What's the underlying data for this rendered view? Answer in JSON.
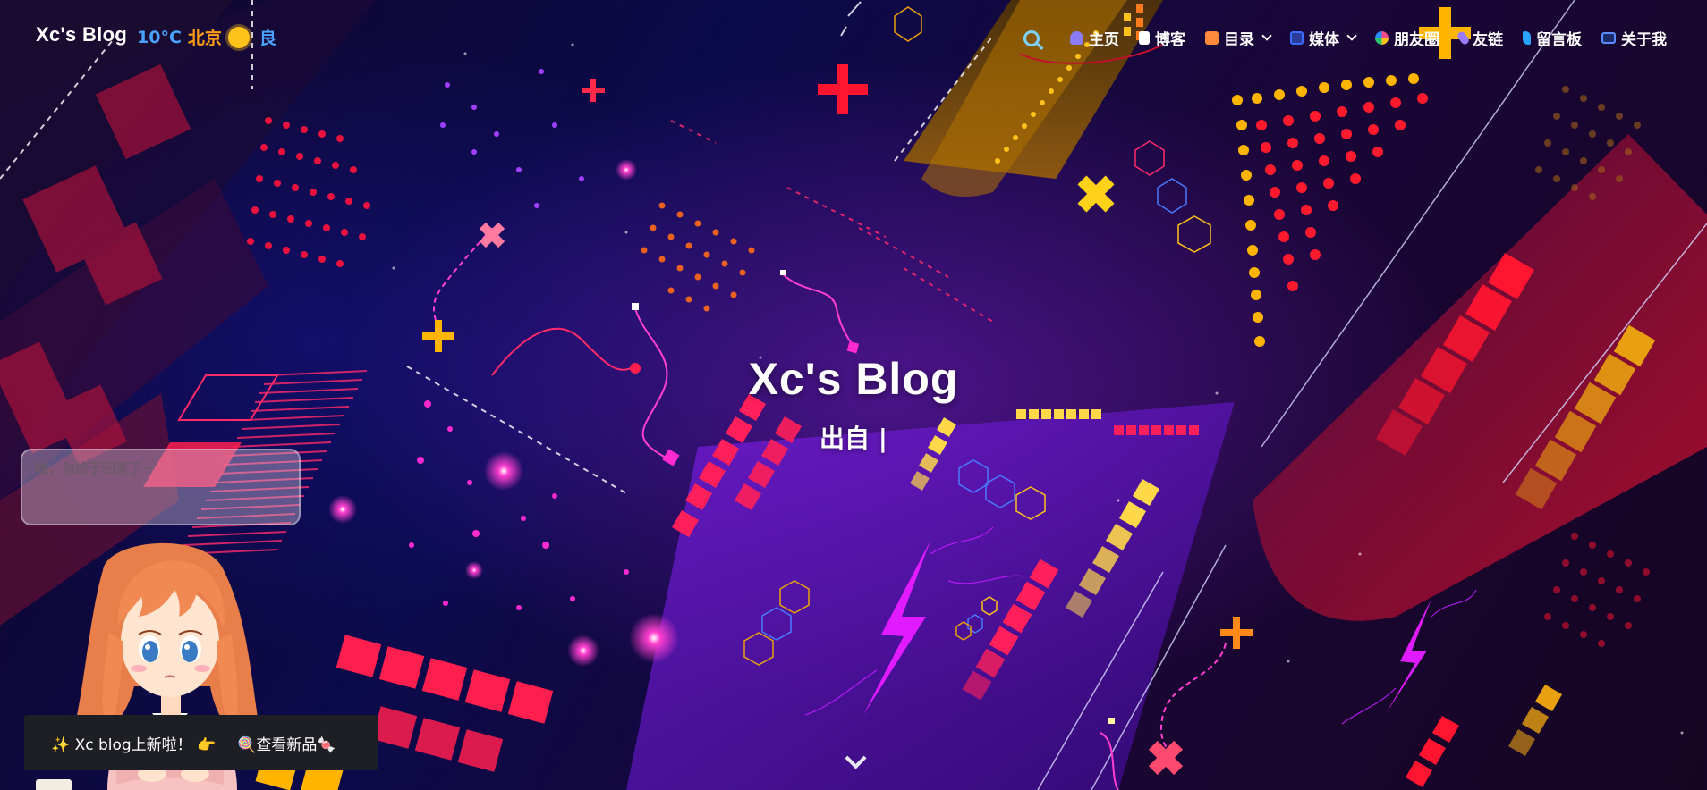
{
  "header": {
    "brand": "Xc's Blog",
    "weather": {
      "temperature": "10°C",
      "city": "北京",
      "icon": "sun-icon",
      "air_quality": "良"
    },
    "menu": [
      {
        "id": "home",
        "label": "主页",
        "icon": "home-icon",
        "dropdown": false,
        "color": "#8b7cf6"
      },
      {
        "id": "blog",
        "label": "博客",
        "icon": "document-icon",
        "dropdown": false,
        "color": "#ffffff"
      },
      {
        "id": "catalog",
        "label": "目录",
        "icon": "list-icon",
        "dropdown": true,
        "color": "#ff8a3c"
      },
      {
        "id": "media",
        "label": "媒体",
        "icon": "media-icon",
        "dropdown": true,
        "color": "#3c6cff"
      },
      {
        "id": "moments",
        "label": "朋友圈",
        "icon": "pinwheel-icon",
        "dropdown": false,
        "color": "#f04a8a"
      },
      {
        "id": "friends",
        "label": "友链",
        "icon": "link-icon",
        "dropdown": false,
        "color": "#9a7cff"
      },
      {
        "id": "guestbook",
        "label": "留言板",
        "icon": "message-icon",
        "dropdown": false,
        "color": "#2aa4ff"
      },
      {
        "id": "about",
        "label": "关于我",
        "icon": "profile-icon",
        "dropdown": false,
        "color": "#5b8cff"
      }
    ]
  },
  "hero": {
    "title": "Xc's Blog",
    "subtitle": "出自 |"
  },
  "mascot": {
    "speech": "哇，你终于回来了~"
  },
  "toast": {
    "message": "✨ Xc blog上新啦！ 👉",
    "action": "🍭查看新品🍬"
  },
  "colors": {
    "accent_blue": "#4aa3ff",
    "accent_orange": "#ff9c1a",
    "neon_red": "#ff1f4f",
    "neon_yellow": "#ffb300",
    "neon_magenta": "#e01bff"
  }
}
